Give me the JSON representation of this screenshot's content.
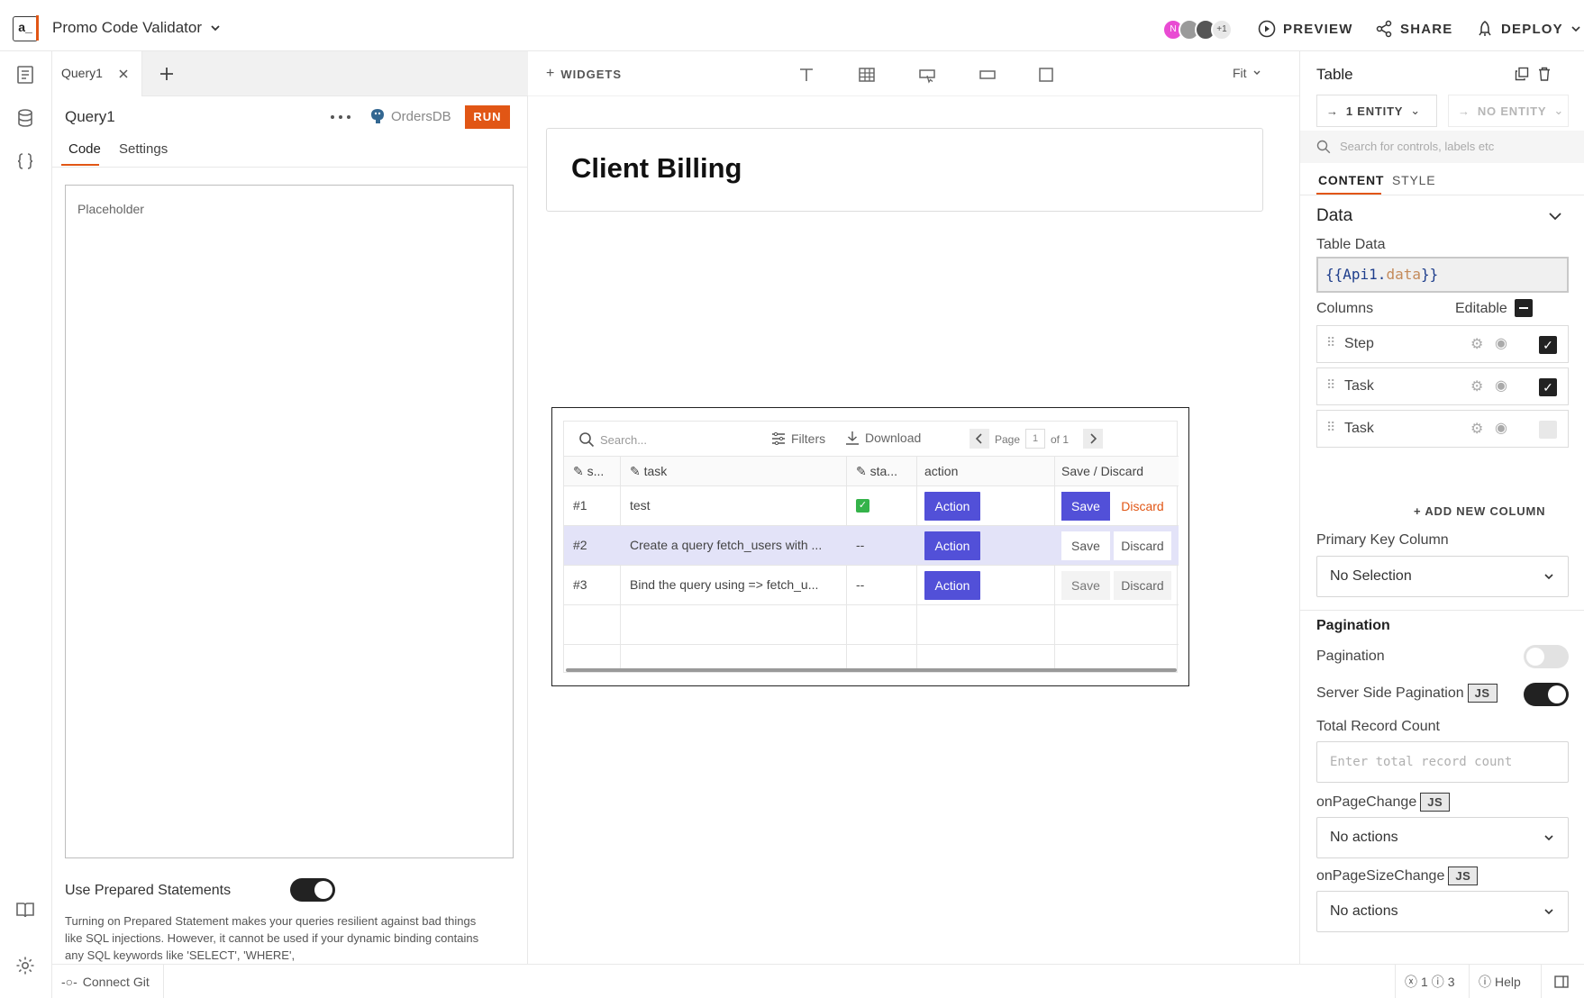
{
  "app": {
    "title": "Promo Code Validator",
    "logo_text": "a_"
  },
  "header": {
    "avatars": [
      "N",
      "",
      ""
    ],
    "avatar_more": "+1",
    "preview": "PREVIEW",
    "share": "SHARE",
    "deploy": "DEPLOY"
  },
  "query_tabs": {
    "tab1": "Query1"
  },
  "query": {
    "name": "Query1",
    "datasource": "OrdersDB",
    "run": "RUN",
    "tabs": [
      "Code",
      "Settings"
    ],
    "editor_placeholder": "Placeholder",
    "prepared_label": "Use Prepared Statements",
    "prepared_help": "Turning on Prepared Statement makes your queries resilient against bad things like SQL injections. However, it cannot be used if your dynamic binding contains any SQL keywords like 'SELECT', 'WHERE',",
    "prepared_on": true
  },
  "canvas": {
    "widgets_label": "WIDGETS",
    "zoom": "Fit",
    "heading": "Client Billing"
  },
  "table": {
    "search_placeholder": "Search...",
    "filters": "Filters",
    "download": "Download",
    "page_label": "Page",
    "page_value": "1",
    "page_of": "of 1",
    "columns": [
      "s...",
      "task",
      "sta...",
      "action",
      "Save / Discard"
    ],
    "rows": [
      {
        "step": "#1",
        "task": "test",
        "status": "",
        "action": "Action",
        "save": "Save",
        "discard": "Discard"
      },
      {
        "step": "#2",
        "task": "Create a query fetch_users with ...",
        "status": "--",
        "action": "Action",
        "save": "Save",
        "discard": "Discard"
      },
      {
        "step": "#3",
        "task": "Bind the query using => fetch_u...",
        "status": "--",
        "action": "Action",
        "save": "Save",
        "discard": "Discard"
      }
    ]
  },
  "panel": {
    "title": "Table",
    "entity_in": "1 ENTITY",
    "entity_out": "NO ENTITY",
    "search_placeholder": "Search for controls, labels etc",
    "tabs": [
      "CONTENT",
      "STYLE"
    ],
    "data_section": "Data",
    "table_data_label": "Table Data",
    "table_data_value_a": "{{Api1.",
    "table_data_value_b": "data",
    "table_data_value_c": "}}",
    "columns_label": "Columns",
    "editable_label": "Editable",
    "column_items": [
      {
        "name": "Step",
        "editable": true
      },
      {
        "name": "Task",
        "editable": true
      },
      {
        "name": "Task",
        "editable": false
      }
    ],
    "add_column": "ADD NEW COLUMN",
    "primary_key_label": "Primary Key Column",
    "primary_key_value": "No Selection",
    "pagination_section": "Pagination",
    "pagination_label": "Pagination",
    "pagination_on": false,
    "server_pagination_label": "Server Side Pagination",
    "server_pagination_on": true,
    "js": "JS",
    "total_record_label": "Total Record Count",
    "total_record_placeholder": "Enter total record count",
    "on_page_change_label": "onPageChange",
    "on_page_change_value": "No actions",
    "on_page_size_change_label": "onPageSizeChange",
    "on_page_size_change_value": "No actions"
  },
  "footer": {
    "connect_git": "Connect Git",
    "errors": "1",
    "warnings": "3",
    "help": "Help"
  },
  "colors": {
    "accent": "#e15615",
    "brand_purple": "#5250d8",
    "dark": "#393939"
  }
}
